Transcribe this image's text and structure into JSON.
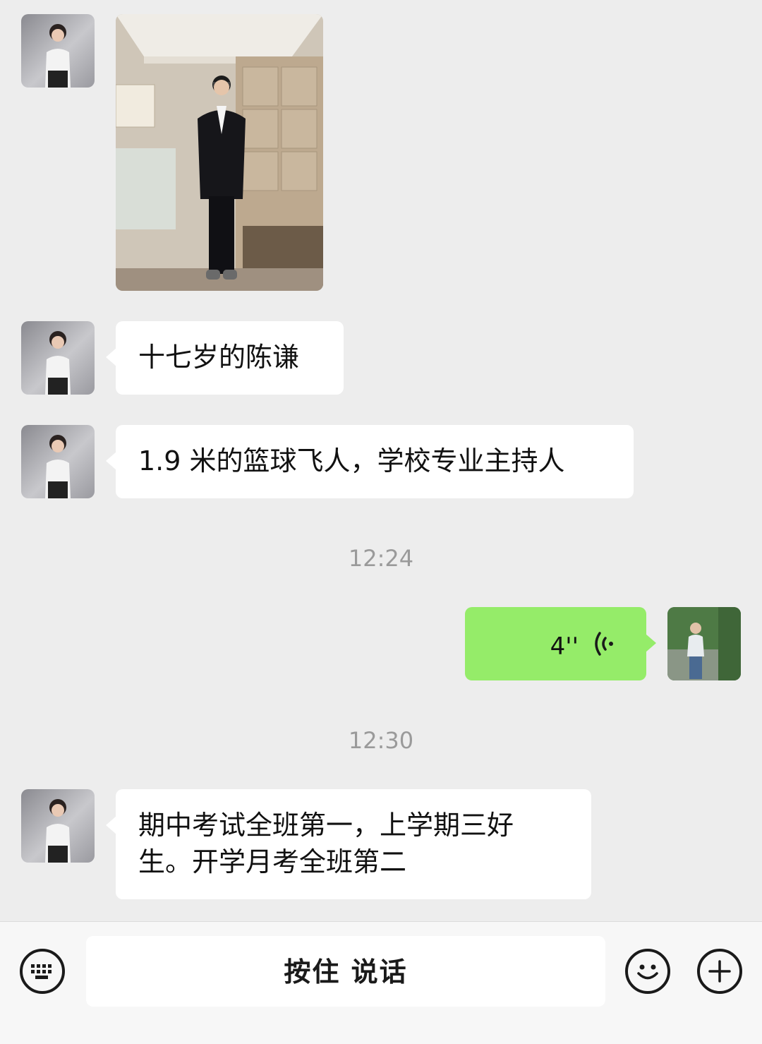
{
  "messages": [
    {
      "type": "image",
      "sender": "other",
      "alt": "照片"
    },
    {
      "type": "text",
      "sender": "other",
      "text": "十七岁的陈谦"
    },
    {
      "type": "text",
      "sender": "other",
      "text": "1.9 米的篮球飞人，学校专业主持人"
    },
    {
      "type": "time",
      "text": "12:24"
    },
    {
      "type": "voice",
      "sender": "self",
      "duration": "4''"
    },
    {
      "type": "time",
      "text": "12:30"
    },
    {
      "type": "text",
      "sender": "other",
      "line1": "期中考试全班第一，上学期三好",
      "line2": "生。开学月考全班第二"
    }
  ],
  "input": {
    "hold_to_talk": "按住 说话"
  },
  "icons": {
    "keyboard": "keyboard-icon",
    "emoji": "emoji-icon",
    "plus": "plus-icon",
    "voice": "voice-wave-icon"
  },
  "colors": {
    "self_bubble": "#95ec69",
    "other_bubble": "#ffffff",
    "background": "#ededed"
  }
}
